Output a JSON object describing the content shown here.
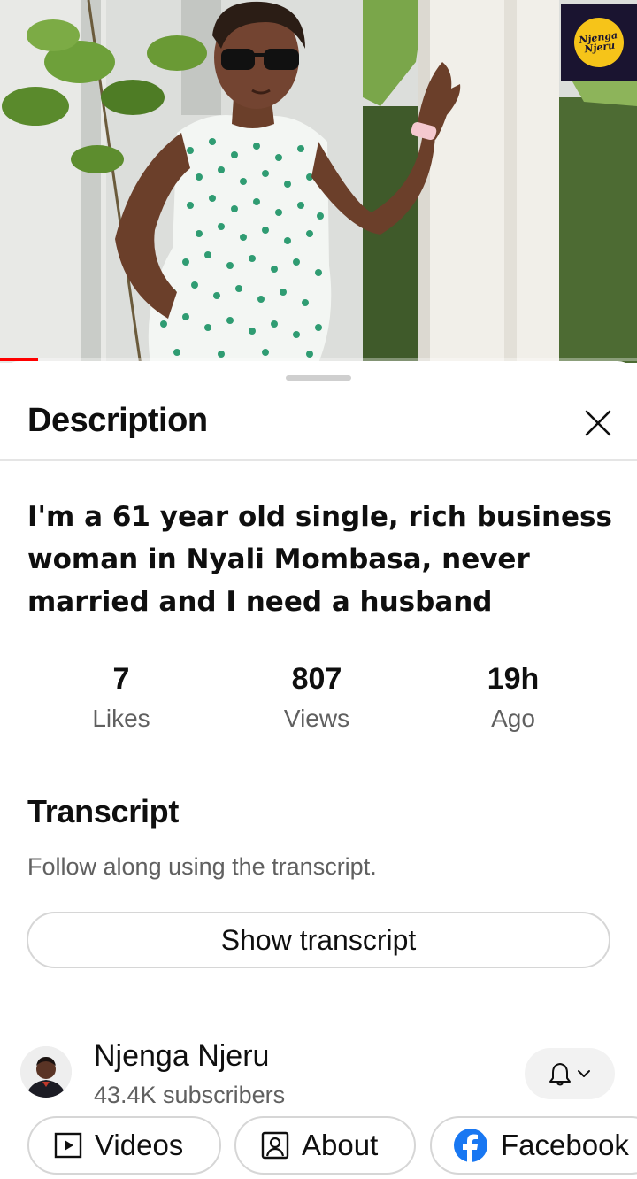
{
  "video": {
    "logo_text": "Njenga Njeru",
    "progress_fraction": 0.06,
    "accent_color": "#ff0000"
  },
  "sheet": {
    "title": "Description",
    "close_icon": "close-icon"
  },
  "description": {
    "video_title": "I'm a 61 year old single, rich business woman in Nyali Mombasa, never married and I need a husband",
    "stats": [
      {
        "value": "7",
        "label": "Likes"
      },
      {
        "value": "807",
        "label": "Views"
      },
      {
        "value": "19h",
        "label": "Ago"
      }
    ]
  },
  "transcript": {
    "heading": "Transcript",
    "subtitle": "Follow along using the transcript.",
    "button_label": "Show transcript"
  },
  "channel": {
    "name": "Njenga Njeru",
    "subscribers": "43.4K subscribers",
    "bell_icon": "bell-icon",
    "chips": [
      {
        "label": "Videos",
        "icon": "video-play-icon"
      },
      {
        "label": "About",
        "icon": "person-icon"
      },
      {
        "label": "Facebook",
        "icon": "facebook-icon"
      }
    ],
    "facebook_color": "#1877f2"
  }
}
